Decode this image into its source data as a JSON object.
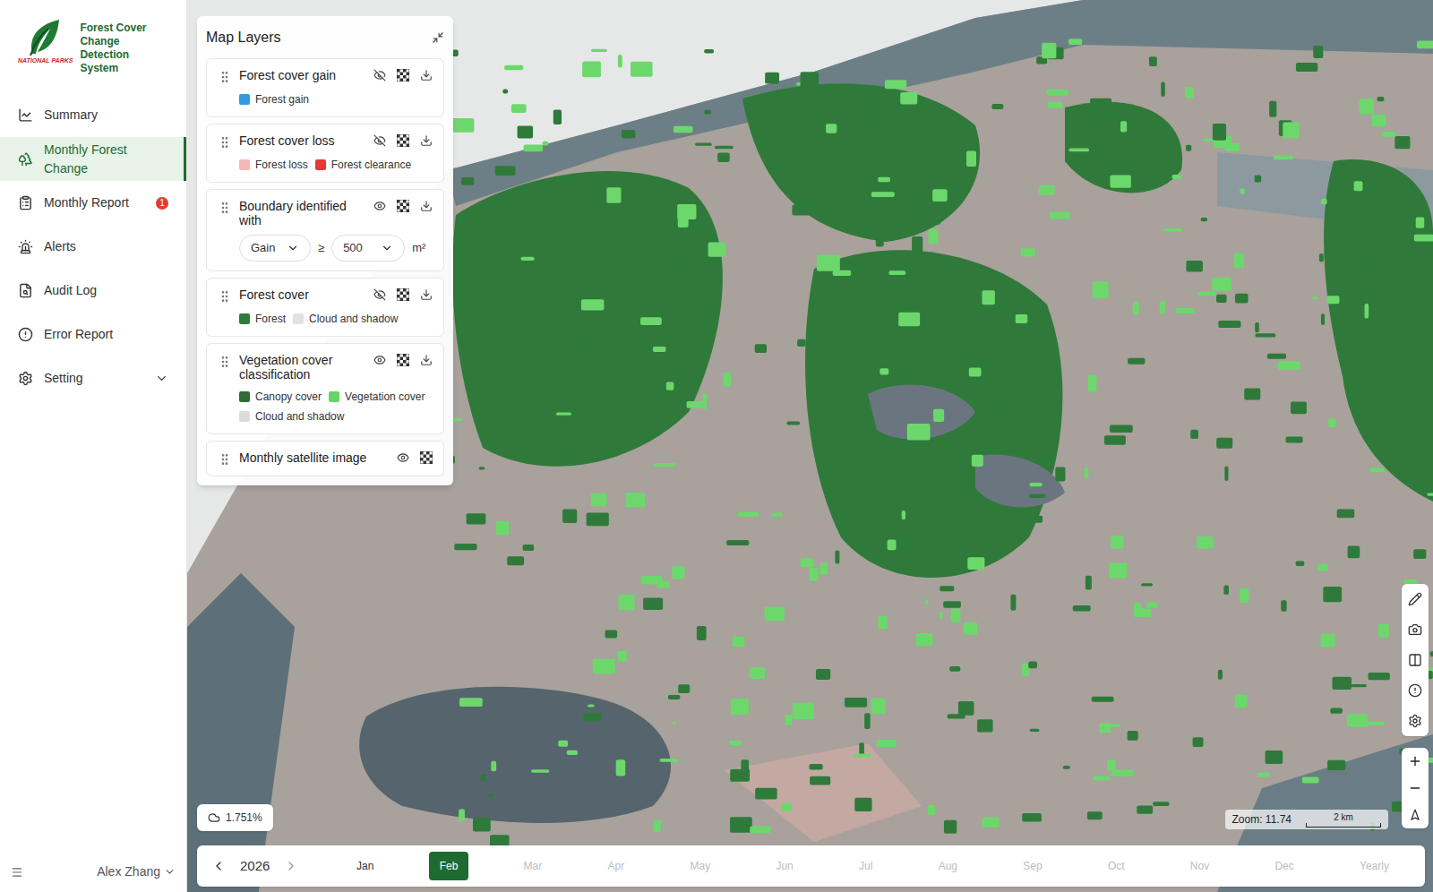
{
  "app": {
    "title": "Forest Cover Change Detection System",
    "org": "NATIONAL PARKS"
  },
  "sidebar": {
    "items": [
      {
        "label": "Summary",
        "selected": false
      },
      {
        "label": "Monthly Forest Change",
        "selected": true
      },
      {
        "label": "Monthly Report",
        "selected": false,
        "badge": "1"
      },
      {
        "label": "Alerts",
        "selected": false
      },
      {
        "label": "Audit Log",
        "selected": false
      },
      {
        "label": "Error Report",
        "selected": false
      },
      {
        "label": "Setting",
        "selected": false,
        "expanded": false
      }
    ]
  },
  "user": {
    "name": "Alex Zhang"
  },
  "layers_panel": {
    "title": "Map Layers",
    "layers": [
      {
        "name": "Forest cover gain",
        "kind": "legend",
        "visible": false,
        "downloadable": true,
        "legend": [
          {
            "label": "Forest gain",
            "color": "#2f9be0"
          }
        ]
      },
      {
        "name": "Forest cover loss",
        "kind": "legend",
        "visible": false,
        "downloadable": true,
        "legend": [
          {
            "label": "Forest loss",
            "color": "#f6b7b7"
          },
          {
            "label": "Forest clearance",
            "color": "#e53935"
          }
        ]
      },
      {
        "name": "Boundary identified with",
        "kind": "filter",
        "visible": true,
        "downloadable": true,
        "filter": {
          "type": "Gain",
          "operator": "≥",
          "value": "500",
          "unit": "m²"
        }
      },
      {
        "name": "Forest cover",
        "kind": "legend",
        "visible": false,
        "downloadable": true,
        "legend": [
          {
            "label": "Forest",
            "color": "#2e7d3a"
          },
          {
            "label": "Cloud and shadow",
            "color": "#e2e2e2"
          }
        ]
      },
      {
        "name": "Vegetation cover classification",
        "kind": "legend",
        "visible": true,
        "downloadable": true,
        "legend": [
          {
            "label": "Canopy cover",
            "color": "#2e6b35"
          },
          {
            "label": "Vegetation cover",
            "color": "#66d466"
          },
          {
            "label": "Cloud and shadow",
            "color": "#dcdcdc"
          }
        ]
      },
      {
        "name": "Monthly satellite image",
        "kind": "plain",
        "visible": true,
        "downloadable": false
      }
    ]
  },
  "map": {
    "cloud": "1.751%",
    "zoom": "Zoom: 11.74",
    "scale": "2 km"
  },
  "timeline": {
    "year": "2026",
    "periods": [
      {
        "label": "Jan",
        "selected": false,
        "disabled": false
      },
      {
        "label": "Feb",
        "selected": true,
        "disabled": false
      },
      {
        "label": "Mar",
        "selected": false,
        "disabled": true
      },
      {
        "label": "Apr",
        "selected": false,
        "disabled": true
      },
      {
        "label": "May",
        "selected": false,
        "disabled": true
      },
      {
        "label": "Jun",
        "selected": false,
        "disabled": true
      },
      {
        "label": "Jul",
        "selected": false,
        "disabled": true
      },
      {
        "label": "Aug",
        "selected": false,
        "disabled": true
      },
      {
        "label": "Sep",
        "selected": false,
        "disabled": true
      },
      {
        "label": "Oct",
        "selected": false,
        "disabled": true
      },
      {
        "label": "Nov",
        "selected": false,
        "disabled": true
      },
      {
        "label": "Dec",
        "selected": false,
        "disabled": true
      },
      {
        "label": "Yearly",
        "selected": false,
        "disabled": true
      }
    ]
  }
}
